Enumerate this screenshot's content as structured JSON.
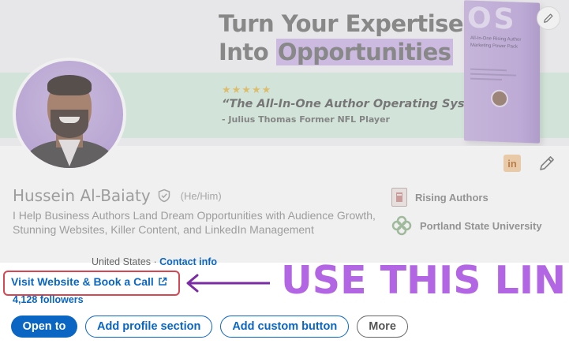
{
  "banner": {
    "headline_line1": "Turn Your Expertise",
    "headline_line2_plain": "Into ",
    "headline_line2_highlight": "Opportunities",
    "stars": "★★★★★",
    "quote": "“The All-In-One Author Operating System!”",
    "attribution": "-  Julius Thomas Former NFL Player",
    "book_title": "OS",
    "book_subtitle": "All-In-One Rising Author Marketing Power Pack",
    "colors": {
      "band": "#d6efe0",
      "highlight": "#cdb5ea",
      "book": "#b99fdb"
    }
  },
  "profile": {
    "name": "Hussein Al-Baiaty",
    "pronouns": "(He/Him)",
    "headline": "I Help Business Authors Land Dream Opportunities with Audience Growth, Stunning Websites, Killer Content, and LinkedIn Management",
    "location": "United States · ",
    "contact_info": "Contact info",
    "website_link": "Visit Website & Book a Call",
    "followers": "4,128 followers"
  },
  "affiliations": [
    {
      "label": "Rising Authors"
    },
    {
      "label": "Portland State University"
    }
  ],
  "actions": {
    "open_to": "Open to",
    "add_profile_section": "Add profile section",
    "add_custom_button": "Add custom button",
    "more": "More"
  },
  "annotation": {
    "callout_text": "USE THIS LINK",
    "callout_color": "#b366e3",
    "box_color": "#d84654"
  },
  "icons": {
    "linkedin": "in"
  },
  "theme": {
    "link_blue": "#0a66c2"
  }
}
